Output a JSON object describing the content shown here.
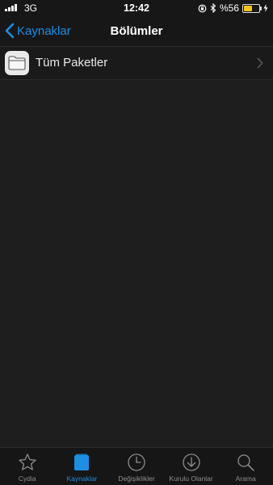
{
  "status_bar": {
    "carrier": "3G",
    "time": "12:42",
    "battery_percent": "%56",
    "battery_level": 0.56,
    "battery_color": "#f5c518",
    "icons": [
      "signal-icon",
      "rotation-lock-icon",
      "bluetooth-icon",
      "battery-icon",
      "charging-bolt-icon"
    ]
  },
  "nav": {
    "back_label": "Kaynaklar",
    "title": "Bölümler"
  },
  "list": {
    "items": [
      {
        "label": "Tüm Paketler",
        "icon": "folder-icon"
      }
    ]
  },
  "tab_bar": {
    "accent_color": "#1c8fe3",
    "inactive_color": "#8f8f8f",
    "active_tab": "Kaynaklar",
    "tabs": [
      {
        "label": "Cydia",
        "icon": "star-icon"
      },
      {
        "label": "Kaynaklar",
        "icon": "sources-box-icon"
      },
      {
        "label": "Değişiklikler",
        "icon": "clock-icon"
      },
      {
        "label": "Kurulu Olanlar",
        "icon": "download-arrow-icon"
      },
      {
        "label": "Arama",
        "icon": "search-icon"
      }
    ]
  }
}
